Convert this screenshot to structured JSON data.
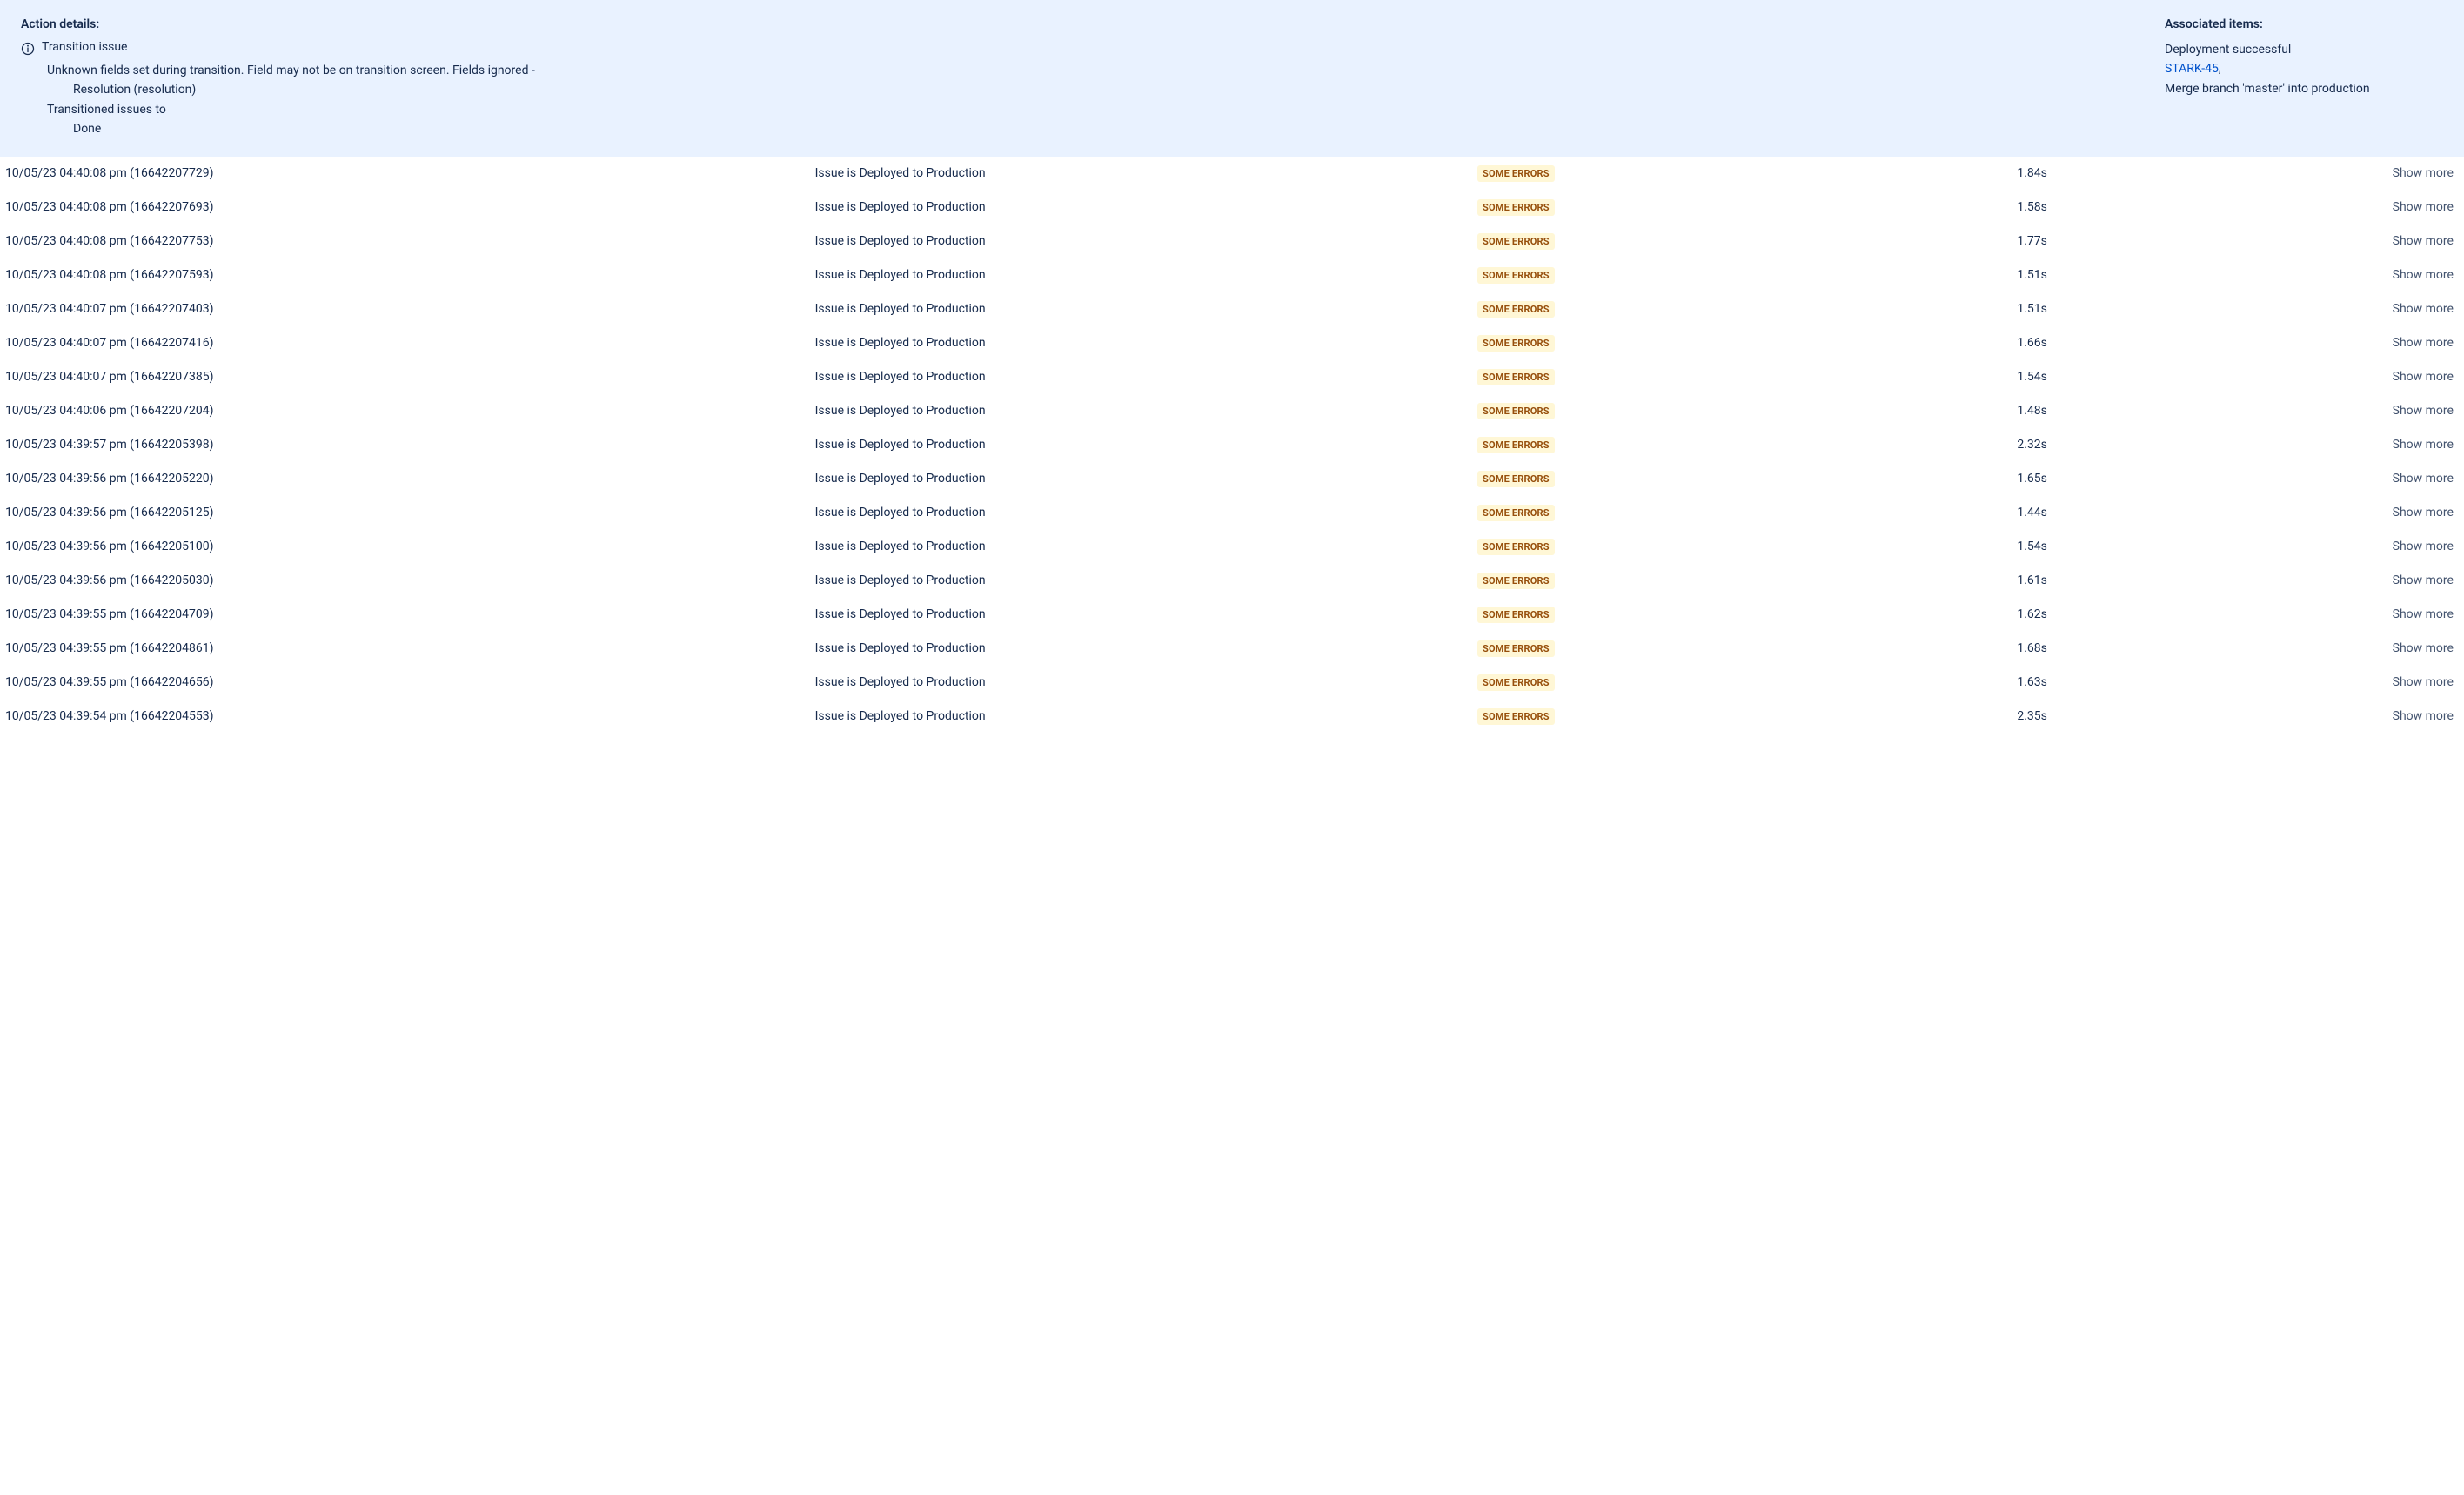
{
  "details": {
    "title": "Action details:",
    "heading": "Transition issue",
    "warning": "Unknown fields set during transition. Field may not be on transition screen. Fields ignored -",
    "ignored_field": "Resolution (resolution)",
    "transitioned_label": "Transitioned issues to",
    "transitioned_value": "Done"
  },
  "associated": {
    "title": "Associated items:",
    "status": "Deployment successful",
    "link": "STARK-45",
    "suffix": ",",
    "commit": "Merge branch 'master' into production"
  },
  "status_label": "SOME ERRORS",
  "show_more_label": "Show more",
  "rows": [
    {
      "ts": "10/05/23 04:40:08 pm (16642207729)",
      "msg": "Issue is Deployed to Production",
      "dur": "1.84s"
    },
    {
      "ts": "10/05/23 04:40:08 pm (16642207693)",
      "msg": "Issue is Deployed to Production",
      "dur": "1.58s"
    },
    {
      "ts": "10/05/23 04:40:08 pm (16642207753)",
      "msg": "Issue is Deployed to Production",
      "dur": "1.77s"
    },
    {
      "ts": "10/05/23 04:40:08 pm (16642207593)",
      "msg": "Issue is Deployed to Production",
      "dur": "1.51s"
    },
    {
      "ts": "10/05/23 04:40:07 pm (16642207403)",
      "msg": "Issue is Deployed to Production",
      "dur": "1.51s"
    },
    {
      "ts": "10/05/23 04:40:07 pm (16642207416)",
      "msg": "Issue is Deployed to Production",
      "dur": "1.66s"
    },
    {
      "ts": "10/05/23 04:40:07 pm (16642207385)",
      "msg": "Issue is Deployed to Production",
      "dur": "1.54s"
    },
    {
      "ts": "10/05/23 04:40:06 pm (16642207204)",
      "msg": "Issue is Deployed to Production",
      "dur": "1.48s"
    },
    {
      "ts": "10/05/23 04:39:57 pm (16642205398)",
      "msg": "Issue is Deployed to Production",
      "dur": "2.32s"
    },
    {
      "ts": "10/05/23 04:39:56 pm (16642205220)",
      "msg": "Issue is Deployed to Production",
      "dur": "1.65s"
    },
    {
      "ts": "10/05/23 04:39:56 pm (16642205125)",
      "msg": "Issue is Deployed to Production",
      "dur": "1.44s"
    },
    {
      "ts": "10/05/23 04:39:56 pm (16642205100)",
      "msg": "Issue is Deployed to Production",
      "dur": "1.54s"
    },
    {
      "ts": "10/05/23 04:39:56 pm (16642205030)",
      "msg": "Issue is Deployed to Production",
      "dur": "1.61s"
    },
    {
      "ts": "10/05/23 04:39:55 pm (16642204709)",
      "msg": "Issue is Deployed to Production",
      "dur": "1.62s"
    },
    {
      "ts": "10/05/23 04:39:55 pm (16642204861)",
      "msg": "Issue is Deployed to Production",
      "dur": "1.68s"
    },
    {
      "ts": "10/05/23 04:39:55 pm (16642204656)",
      "msg": "Issue is Deployed to Production",
      "dur": "1.63s"
    },
    {
      "ts": "10/05/23 04:39:54 pm (16642204553)",
      "msg": "Issue is Deployed to Production",
      "dur": "2.35s"
    }
  ]
}
